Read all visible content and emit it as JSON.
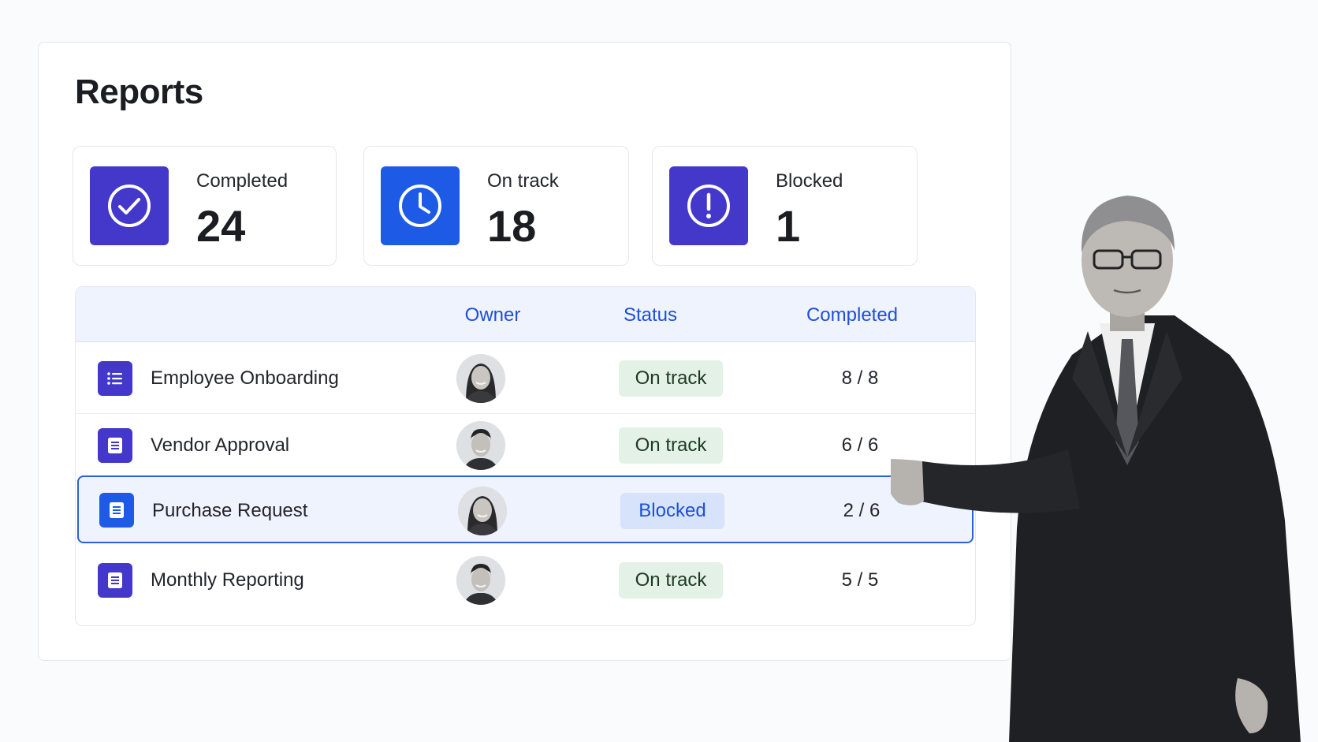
{
  "page": {
    "title": "Reports"
  },
  "stats": [
    {
      "label": "Completed",
      "value": "24",
      "icon": "check-circle-icon",
      "color": "#4338ca"
    },
    {
      "label": "On track",
      "value": "18",
      "icon": "clock-icon",
      "color": "#1d5be6"
    },
    {
      "label": "Blocked",
      "value": "1",
      "icon": "exclamation-circle-icon",
      "color": "#4338ca"
    }
  ],
  "table": {
    "columns": [
      "",
      "Owner",
      "Status",
      "Completed"
    ],
    "rows": [
      {
        "name": "Employee Onboarding",
        "icon": "list-icon",
        "owner": "female-avatar",
        "status": "On track",
        "completed": "8 / 8"
      },
      {
        "name": "Vendor Approval",
        "icon": "document-icon",
        "owner": "male-avatar",
        "status": "On track",
        "completed": "6 / 6"
      },
      {
        "name": "Purchase Request",
        "icon": "document-icon",
        "owner": "female-avatar",
        "status": "Blocked",
        "completed": "2 / 6",
        "selected": true
      },
      {
        "name": "Monthly Reporting",
        "icon": "document-icon",
        "owner": "male-avatar",
        "status": "On track",
        "completed": "5 / 5"
      }
    ]
  },
  "colors": {
    "accent": "#1f4fd6",
    "indigo": "#4338ca",
    "ontrack_bg": "#e3f1e6",
    "blocked_bg": "#d6e3fb"
  }
}
